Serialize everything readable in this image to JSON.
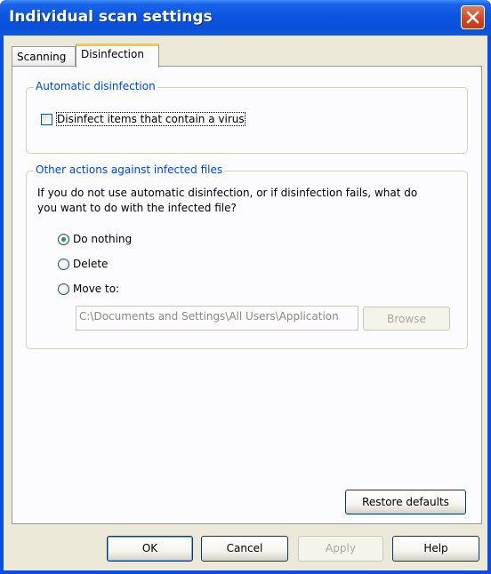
{
  "window": {
    "title": "Individual scan settings"
  },
  "tabs": [
    {
      "label": "Scanning",
      "active": false
    },
    {
      "label": "Disinfection",
      "active": true
    }
  ],
  "auto_group": {
    "legend": "Automatic disinfection",
    "checkbox": {
      "label": "Disinfect items that contain a virus",
      "checked": false
    }
  },
  "other_group": {
    "legend": "Other actions against infected files",
    "description_line1": "If you do not use automatic disinfection, or if disinfection fails, what do",
    "description_line2": "you want to do with the infected file?",
    "options": [
      {
        "label": "Do nothing",
        "selected": true
      },
      {
        "label": "Delete",
        "selected": false
      },
      {
        "label": "Move to:",
        "selected": false
      }
    ],
    "path_value": "C:\\Documents and Settings\\All Users\\Application",
    "browse_label": "Browse"
  },
  "restore_defaults_label": "Restore defaults",
  "footer": {
    "ok": "OK",
    "cancel": "Cancel",
    "apply": "Apply",
    "help": "Help"
  },
  "colors": {
    "accent": "#0046d5",
    "titlebar": "#0a4fd8",
    "dialog_bg": "#ece9d8",
    "radio_dot": "#21a121"
  }
}
